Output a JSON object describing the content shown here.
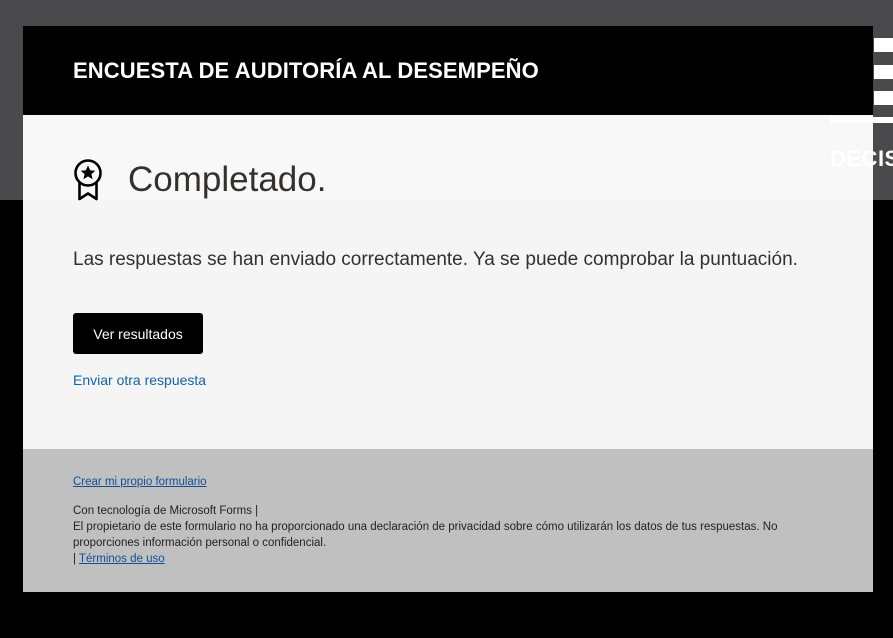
{
  "background": {
    "logo_text": "DECIS",
    "top_color": "#4a4a4c",
    "bottom_color": "#000000"
  },
  "form": {
    "title": "ENCUESTA DE AUDITORÍA AL DESEMPEÑO",
    "status_icon": "ribbon-award-icon",
    "status_heading": "Completado.",
    "message": "Las respuestas se han enviado correctamente. Ya se puede comprobar la puntuación.",
    "view_results_label": "Ver resultados",
    "submit_another_label": "Enviar otra respuesta"
  },
  "footer": {
    "create_form_label": "Crear mi propio formulario",
    "powered_by": "Con tecnología de Microsoft Forms |",
    "privacy_notice": "El propietario de este formulario no ha proporcionado una declaración de privacidad sobre cómo utilizarán los datos de tus respuestas. No proporciones información personal o confidencial.",
    "separator": "|",
    "terms_label": "Términos de uso"
  },
  "colors": {
    "header_bg": "#000000",
    "button_bg": "#000000",
    "link": "#1464a8",
    "footer_bg": "#c0c0c0"
  }
}
